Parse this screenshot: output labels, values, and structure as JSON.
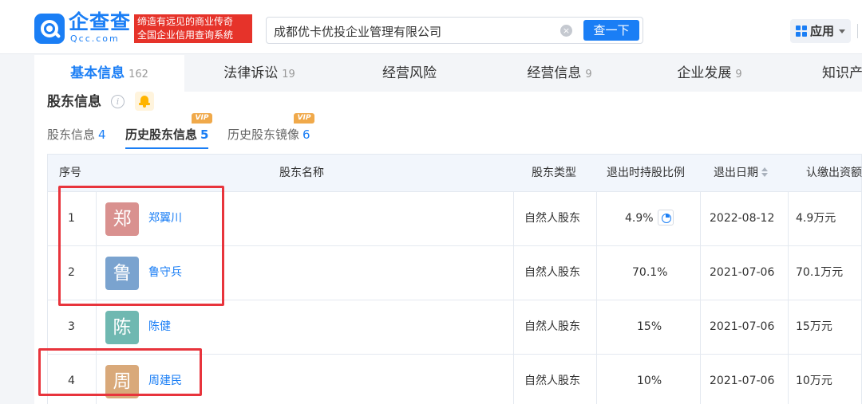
{
  "header": {
    "logo_cn": "企查查",
    "logo_en": "Qcc.com",
    "slogan_line1": "缔造有远见的商业传奇",
    "slogan_line2": "全国企业信用查询系统",
    "search_value": "成都优卡优投企业管理有限公司",
    "clear_icon": "×",
    "search_button": "查一下",
    "apps_label": "应用"
  },
  "tabs": [
    {
      "label": "基本信息",
      "count": "162"
    },
    {
      "label": "法律诉讼",
      "count": "19"
    },
    {
      "label": "经营风险",
      "count": ""
    },
    {
      "label": "经营信息",
      "count": "9"
    },
    {
      "label": "企业发展",
      "count": "9"
    },
    {
      "label": "知识产",
      "count": ""
    }
  ],
  "section": {
    "title": "股东信息",
    "info_icon": "i"
  },
  "subtabs": [
    {
      "label": "股东信息",
      "count": "4"
    },
    {
      "label": "历史股东信息",
      "count": "5"
    },
    {
      "label": "历史股东镜像",
      "count": "6"
    }
  ],
  "vip_label": "VIP",
  "table": {
    "headers": [
      "序号",
      "股东名称",
      "股东类型",
      "退出时持股比例",
      "退出日期",
      "认缴出资额"
    ],
    "rows": [
      {
        "index": "1",
        "avatar_char": "郑",
        "name": "郑翼川",
        "type": "自然人股东",
        "ratio": "4.9%",
        "date": "2022-08-12",
        "amount": "4.9万元",
        "avatar_color": "#d9918f"
      },
      {
        "index": "2",
        "avatar_char": "鲁",
        "name": "鲁守兵",
        "type": "自然人股东",
        "ratio": "70.1%",
        "date": "2021-07-06",
        "amount": "70.1万元",
        "avatar_color": "#7aa3cf"
      },
      {
        "index": "3",
        "avatar_char": "陈",
        "name": "陈健",
        "type": "自然人股东",
        "ratio": "15%",
        "date": "2021-07-06",
        "amount": "15万元",
        "avatar_color": "#6fb8b1"
      },
      {
        "index": "4",
        "avatar_char": "周",
        "name": "周建民",
        "type": "自然人股东",
        "ratio": "10%",
        "date": "2021-07-06",
        "amount": "10万元",
        "avatar_color": "#d9a97a"
      }
    ]
  },
  "colors": {
    "brand": "#1a7ef5",
    "slogan_bg": "#e6332a",
    "highlight": "#e8343c",
    "vip": "#f0a94a"
  }
}
